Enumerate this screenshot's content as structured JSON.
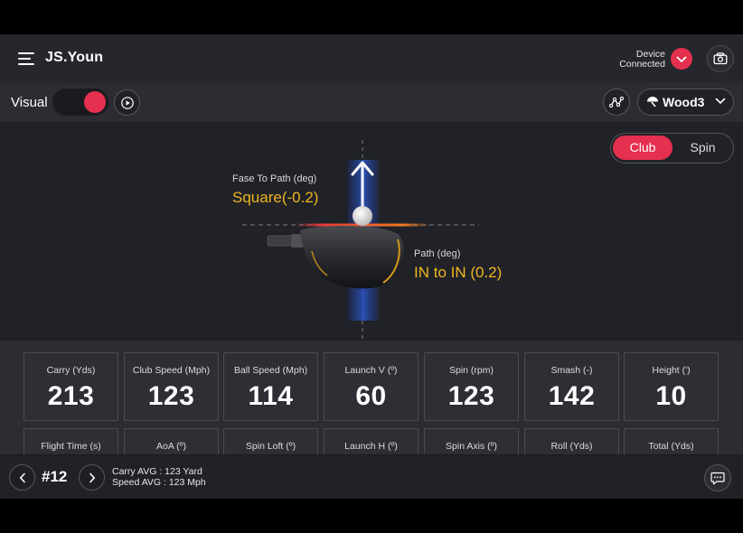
{
  "header": {
    "user_name": "JS.Youn",
    "device_status_line1": "Device",
    "device_status_line2": "Connected"
  },
  "toolbar": {
    "visual_label": "Visual",
    "visual_toggle_on": true,
    "club_name": "Wood3"
  },
  "visual": {
    "segments": [
      "Club",
      "Spin"
    ],
    "selected_segment": "Club",
    "face_to_path_label": "Fase To Path (deg)",
    "face_to_path_value": "Square(-0.2)",
    "path_label": "Path (deg)",
    "path_value": "IN to IN (0.2)"
  },
  "stats": {
    "row1": [
      {
        "label": "Carry (Yds)",
        "value": "213"
      },
      {
        "label": "Club Speed (Mph)",
        "value": "123"
      },
      {
        "label": "Ball Speed (Mph)",
        "value": "114"
      },
      {
        "label": "Launch V (º)",
        "value": "60"
      },
      {
        "label": "Spin (rpm)",
        "value": "123"
      },
      {
        "label": "Smash (-)",
        "value": "142"
      },
      {
        "label": "Height (')",
        "value": "10"
      }
    ],
    "row2": [
      {
        "label": "Flight Time (s)"
      },
      {
        "label": "AoA (º)"
      },
      {
        "label": "Spin Loft (º)"
      },
      {
        "label": "Launch H (º)"
      },
      {
        "label": "Spin Axis (º)"
      },
      {
        "label": "Roll (Yds)"
      },
      {
        "label": "Total (Yds)"
      }
    ]
  },
  "footer": {
    "shot_number": "#12",
    "carry_avg": "Carry AVG : 123 Yard",
    "speed_avg": "Speed AVG : 123 Mph"
  },
  "colors": {
    "accent": "#e5304f",
    "highlight": "#f0b61f",
    "background": "#202228",
    "panel": "#2b2d33"
  },
  "icons": {
    "menu": "menu-icon",
    "check": "check-icon",
    "camera": "camera-icon",
    "play": "play-icon",
    "path": "path-icon",
    "ball": "golf-ball-icon",
    "dropdown": "chevron-down-icon",
    "prev": "chevron-left-icon",
    "next": "chevron-right-icon",
    "chat": "chat-icon"
  }
}
